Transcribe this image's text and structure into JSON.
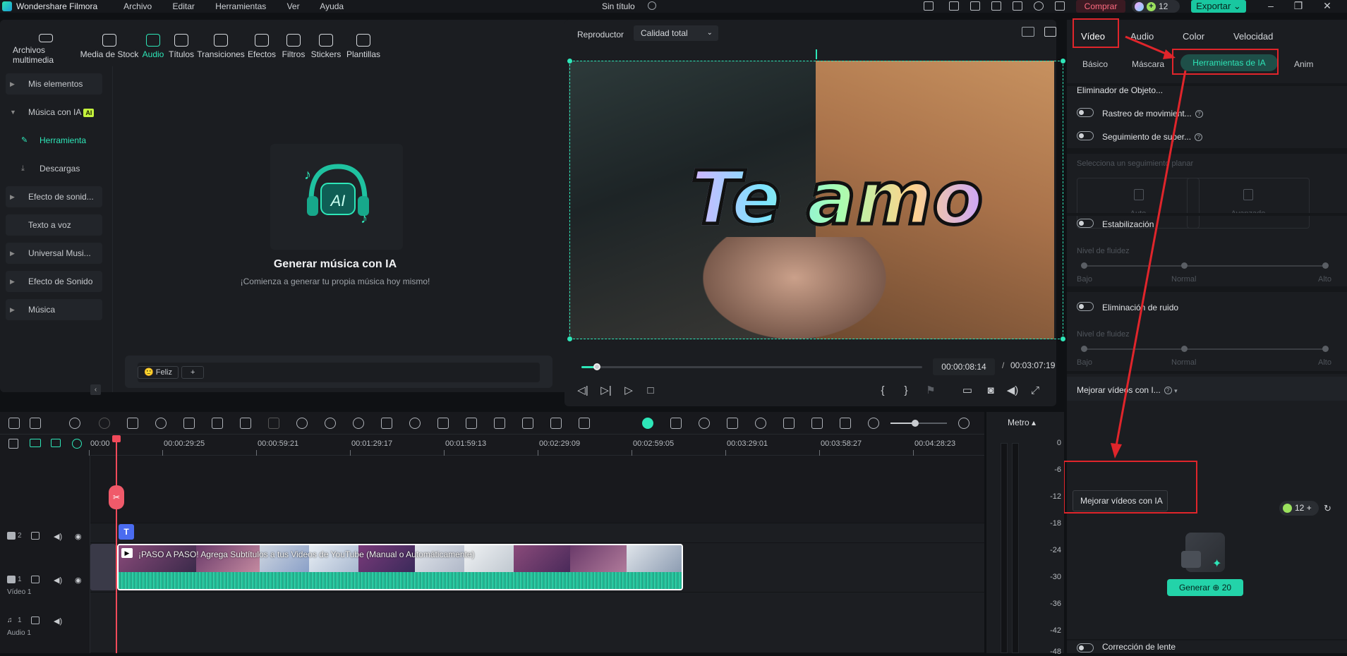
{
  "titlebar": {
    "app_name": "Wondershare Filmora",
    "menu": [
      "Archivo",
      "Editar",
      "Herramientas",
      "Ver",
      "Ayuda"
    ],
    "doc_title": "Sin título",
    "buy_label": "Comprar",
    "credits": "12",
    "export_label": "Exportar"
  },
  "media_tabs": [
    "Archivos multimedia",
    "Media de Stock",
    "Audio",
    "Títulos",
    "Transiciones",
    "Efectos",
    "Filtros",
    "Stickers",
    "Plantillas"
  ],
  "sidebar": {
    "items": [
      "Mis elementos",
      "Música con IA",
      "Herramienta",
      "Descargas",
      "Efecto de sonid...",
      "Texto a voz",
      "Universal Musi...",
      "Efecto de Sonido",
      "Música"
    ],
    "ai_badge": "AI"
  },
  "ai_music": {
    "hero_text": "AI",
    "title": "Generar música con IA",
    "subtitle": "¡Comienza a generar tu propia música hoy mismo!",
    "chip_mood": "Feliz",
    "chip_add": "+"
  },
  "player": {
    "label": "Reproductor",
    "quality": "Calidad total",
    "overlay_text": "Te amo",
    "time_current": "00:00:08:14",
    "time_separator": "/",
    "time_total": "00:03:07:19",
    "progress": 0.045
  },
  "inspector": {
    "tabs": [
      "Vídeo",
      "Audio",
      "Color",
      "Velocidad"
    ],
    "sub_tabs": [
      "Básico",
      "Máscara",
      "Herramientas de IA",
      "Anim"
    ],
    "object_remover": "Eliminador de Objeto...",
    "motion_tracking": "Rastreo de movimient...",
    "surface_tracking": "Seguimiento de super...",
    "planar_hint": "Selecciona un seguimiento planar",
    "auto_label": "Auto",
    "advanced_label": "Avanzado",
    "stabilization": "Estabilización",
    "smoothness": "Nivel de fluidez",
    "low": "Bajo",
    "normal": "Normal",
    "high": "Alto",
    "denoise": "Eliminación de ruido",
    "enhance": "Mejorar vídeos con I...",
    "enhance_tooltip": "Mejorar vídeos con IA",
    "credits": "12",
    "generate": "Generar",
    "generate_cost": "20",
    "lens_correction": "Corrección de lente"
  },
  "timeline": {
    "ruler": [
      "00:00",
      "00:00:29:25",
      "00:00:59:21",
      "00:01:29:17",
      "00:01:59:13",
      "00:02:29:09",
      "00:02:59:05",
      "00:03:29:01",
      "00:03:58:27",
      "00:04:28:23"
    ],
    "track_video2": "2",
    "track_video1": "1",
    "video_label": "Vídeo 1",
    "track_audio1": "1",
    "audio_label": "Audio 1",
    "clip_title": "¡PASO A PASO! Agrega Subtítulos a tus Videos de YouTube (Manual o Automáticamente)",
    "text_marker": "T"
  },
  "meter": {
    "title": "Metro",
    "labels": [
      "0",
      "-6",
      "-12",
      "-18",
      "-24",
      "-30",
      "-36",
      "-42",
      "-48"
    ]
  },
  "colors": {
    "accent": "#2ee6b8",
    "annotation_red": "#e0252b",
    "playhead": "#f04a5a"
  }
}
